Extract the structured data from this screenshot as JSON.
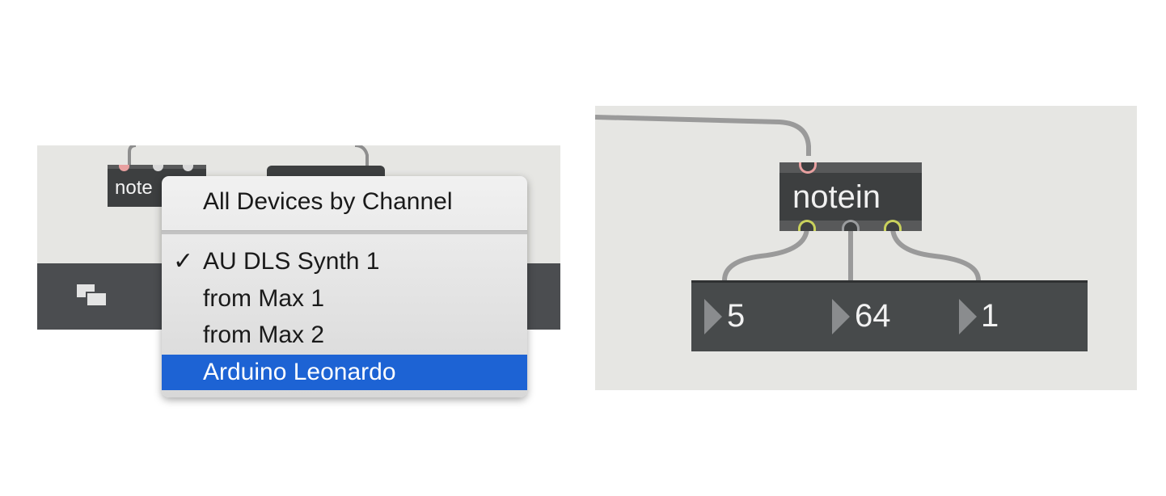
{
  "left_panel": {
    "object_partial_text": "note",
    "device_menu": {
      "header_item": "All Devices by Channel",
      "items": [
        {
          "label": "AU DLS Synth 1",
          "checked": true,
          "highlighted": false
        },
        {
          "label": "from Max 1",
          "checked": false,
          "highlighted": false
        },
        {
          "label": "from Max 2",
          "checked": false,
          "highlighted": false
        },
        {
          "label": "Arduino Leonardo",
          "checked": false,
          "highlighted": true
        }
      ],
      "check_glyph": "✓",
      "highlight_color": "#1d63d4"
    },
    "toolbar_icon": "presentation-mode-icon"
  },
  "right_panel": {
    "object_label": "notein",
    "outputs": [
      {
        "value": "5"
      },
      {
        "value": "64"
      },
      {
        "value": "1"
      }
    ]
  },
  "colors": {
    "patcher_bg": "#e6e6e3",
    "object_bg": "#3d3f40",
    "toolbar_bg": "#4b4d50",
    "inlet_color": "#e8a0a0",
    "outlet_color": "#c9d15c"
  }
}
